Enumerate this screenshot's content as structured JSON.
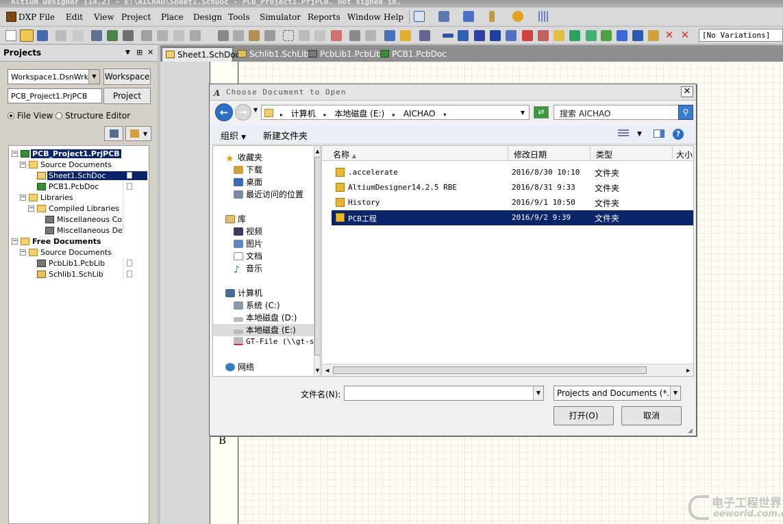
{
  "window": {
    "title": "Altium Designer (14.2) - E:\\AICHAO\\Sheet1.SchDoc - PCB_Project1.PrjPCB. Not signed in."
  },
  "menu": [
    "DXP",
    "File",
    "Edit",
    "View",
    "Project",
    "Place",
    "Design",
    "Tools",
    "Simulator",
    "Reports",
    "Window",
    "Help"
  ],
  "toolbar": {
    "variations": "[No Variations]"
  },
  "projects_panel": {
    "title": "Projects",
    "workspace_value": "Workspace1.DsnWrk",
    "workspace_button": "Workspace",
    "project_value": "PCB_Project1.PrjPCB",
    "project_button": "Project",
    "view_file": "File View",
    "view_structure": "Structure Editor",
    "tree": [
      "PCB_Project1.PrjPCB",
      "Source Documents",
      "Sheet1.SchDoc",
      "PCB1.PcbDoc",
      "Libraries",
      "Compiled Libraries",
      "Miscellaneous Con",
      "Miscellaneous Dev",
      "Free Documents",
      "Source Documents",
      "PcbLib1.PcbLib",
      "Schlib1.SchLib"
    ]
  },
  "doc_tabs": [
    "Sheet1.SchDoc",
    "Schlib1.SchLib",
    "PcbLib1.PcbLib",
    "PCB1.PcbDoc"
  ],
  "sheet": {
    "zone_letter": "B"
  },
  "watermark": {
    "line1": "电子工程世界",
    "line2": "eeworld.com.cn"
  },
  "dialog": {
    "title": "Choose Document to Open",
    "address": [
      "计算机",
      "本地磁盘 (E:)",
      "AICHAO"
    ],
    "search_placeholder": "搜索 AICHAO",
    "cmd_organize": "组织",
    "cmd_new_folder": "新建文件夹",
    "nav": {
      "favorites": "收藏夹",
      "downloads": "下载",
      "desktop": "桌面",
      "recent": "最近访问的位置",
      "libraries": "库",
      "videos": "视频",
      "pictures": "图片",
      "documents": "文档",
      "music": "音乐",
      "computer": "计算机",
      "drive_c": "系统 (C:)",
      "drive_d": "本地磁盘 (D:)",
      "drive_e": "本地磁盘 (E:)",
      "gt_file": "GT-File (\\\\gt-s",
      "network": "网络"
    },
    "columns": {
      "name": "名称",
      "date": "修改日期",
      "type": "类型",
      "size": "大小"
    },
    "files": [
      {
        "name": ".accelerate",
        "date": "2016/8/30 10:10",
        "type": "文件夹"
      },
      {
        "name": "AltiumDesigner14.2.5 RBE",
        "date": "2016/8/31 9:33",
        "type": "文件夹"
      },
      {
        "name": "History",
        "date": "2016/9/1 10:50",
        "type": "文件夹"
      },
      {
        "name": "PCB工程",
        "date": "2016/9/2 9:39",
        "type": "文件夹"
      }
    ],
    "filename_label": "文件名(N):",
    "filename_value": "",
    "filter_value": "Projects and Documents (*.D",
    "open_button": "打开(O)",
    "cancel_button": "取消"
  }
}
